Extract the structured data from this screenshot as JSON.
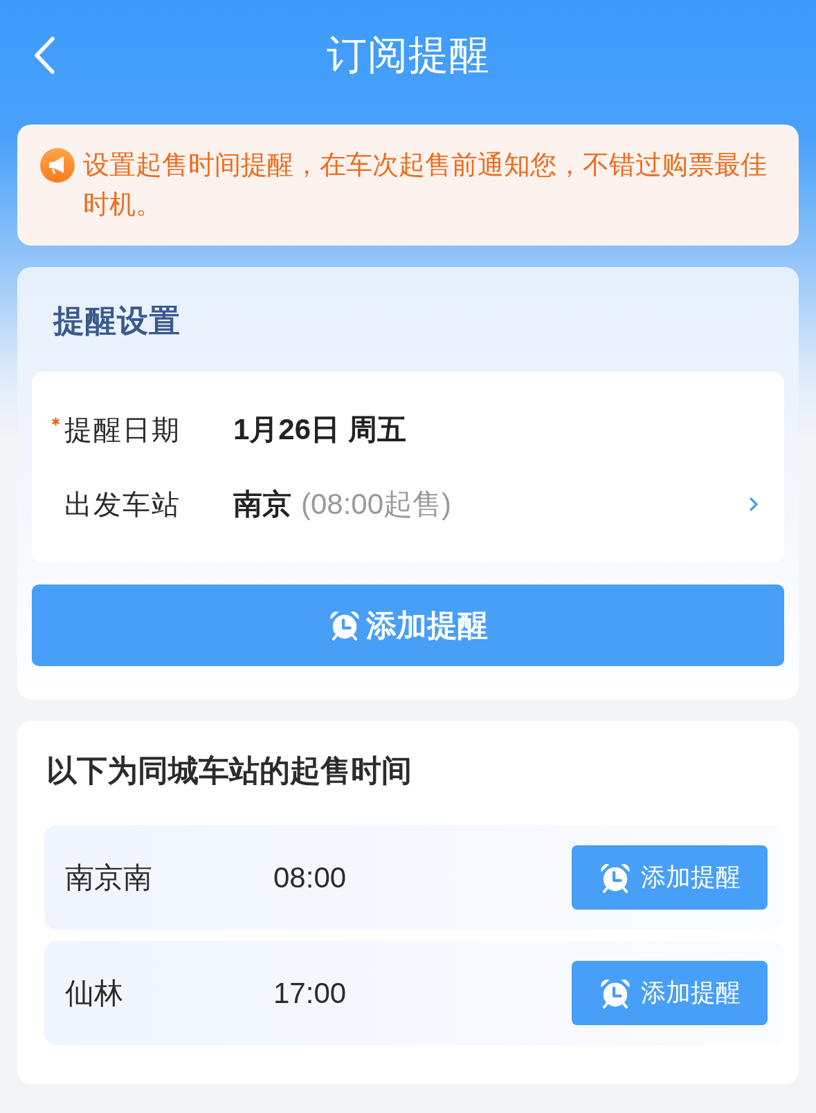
{
  "header": {
    "title": "订阅提醒"
  },
  "notice": {
    "text": "设置起售时间提醒，在车次起售前通知您，不错过购票最佳时机。"
  },
  "settings": {
    "title": "提醒设置",
    "fields": [
      {
        "kind": "static",
        "label": "提醒日期",
        "required": true,
        "value": "1月26日 周五"
      },
      {
        "kind": "picker",
        "label": "出发车站",
        "required": false,
        "value": "南京",
        "note": "(08:00起售)"
      }
    ],
    "button": "添加提醒"
  },
  "same_city": {
    "title": "以下为同城车站的起售时间",
    "stations": [
      {
        "name": "南京南",
        "time": "08:00",
        "button": "添加提醒"
      },
      {
        "name": "仙林",
        "time": "17:00",
        "button": "添加提醒"
      }
    ]
  }
}
